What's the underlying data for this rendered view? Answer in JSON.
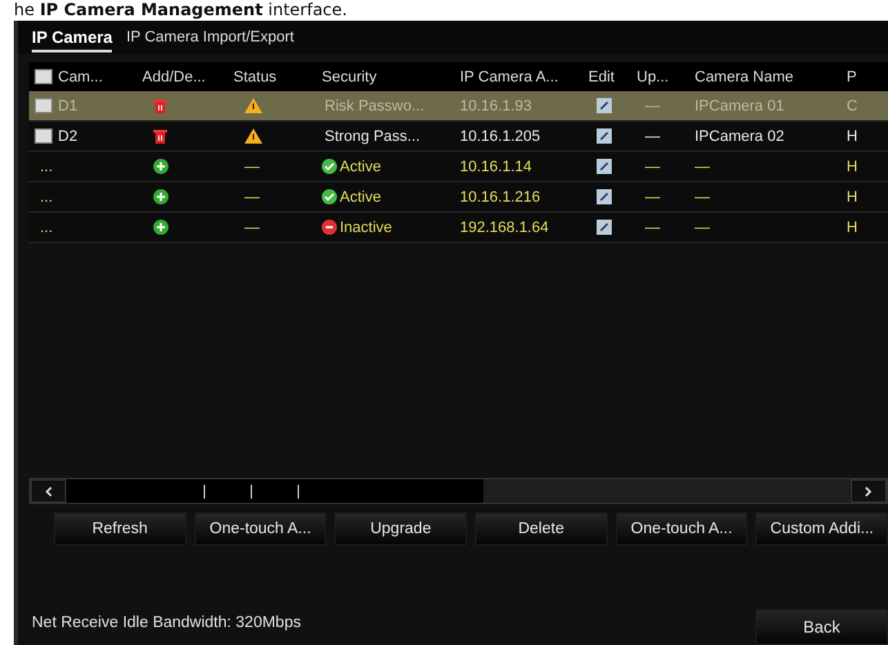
{
  "caption": "he **IP Camera Management** interface.",
  "header_checked": false,
  "tabs": [
    {
      "label": "IP Camera",
      "selected": true
    },
    {
      "label": "IP Camera Import/Export",
      "selected": false
    }
  ],
  "table": {
    "columns": [
      "Cam...",
      "Add/De...",
      "Status",
      "Security",
      "IP Camera A...",
      "Edit",
      "Up...",
      "Camera Name",
      "P"
    ],
    "rows": [
      {
        "kind": "added",
        "selected": true,
        "checked": false,
        "name": "D1",
        "security": {
          "text": "Risk Passwo..."
        },
        "ip": "10.16.1.93",
        "upgrade": "—",
        "camera_name": "IPCamera 01",
        "column_9": "C"
      },
      {
        "kind": "added",
        "selected": false,
        "checked": false,
        "name": "D2",
        "security": {
          "text": "Strong Pass..."
        },
        "ip": "10.16.1.205",
        "upgrade": "—",
        "camera_name": "IPCamera 02",
        "column_9": "H"
      },
      {
        "kind": "found",
        "selected": false,
        "name": "...",
        "status": "—",
        "security": {
          "text": "Active",
          "active": true
        },
        "ip": "10.16.1.14",
        "upgrade": "—",
        "camera_name": "—",
        "column_9": "H"
      },
      {
        "kind": "found",
        "selected": false,
        "name": "...",
        "status": "—",
        "security": {
          "text": "Active",
          "active": true
        },
        "ip": "10.16.1.216",
        "upgrade": "—",
        "camera_name": "—",
        "column_9": "H"
      },
      {
        "kind": "found",
        "selected": false,
        "name": "...",
        "status": "—",
        "security": {
          "text": "Inactive",
          "active": false
        },
        "ip": "192.168.1.64",
        "upgrade": "—",
        "camera_name": "—",
        "column_9": "H"
      }
    ]
  },
  "buttons": [
    "Refresh",
    "One-touch A...",
    "Upgrade",
    "Delete",
    "One-touch A...",
    "Custom Addi..."
  ],
  "status_bar": "Net Receive Idle Bandwidth: 320Mbps",
  "back_button": "Back"
}
